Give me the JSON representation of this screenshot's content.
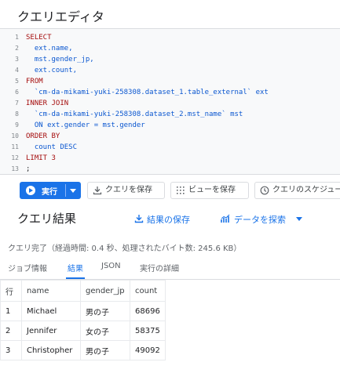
{
  "editor": {
    "title": "クエリエディタ",
    "lines": [
      {
        "num": "1",
        "text": "SELECT",
        "kind": "kw"
      },
      {
        "num": "2",
        "text": "  ext.name,",
        "kind": "code"
      },
      {
        "num": "3",
        "text": "  mst.gender_jp,",
        "kind": "code"
      },
      {
        "num": "4",
        "text": "  ext.count,",
        "kind": "code"
      },
      {
        "num": "5",
        "text": "FROM",
        "kind": "kw"
      },
      {
        "num": "6",
        "text": "  `cm-da-mikami-yuki-258308.dataset_1.table_external` ext",
        "kind": "code"
      },
      {
        "num": "7",
        "text": "INNER JOIN",
        "kind": "kw"
      },
      {
        "num": "8",
        "text": "  `cm-da-mikami-yuki-258308.dataset_2.mst_name` mst",
        "kind": "code"
      },
      {
        "num": "9",
        "text": "  ON ext.gender = mst.gender",
        "kind": "code"
      },
      {
        "num": "10",
        "text": "ORDER BY",
        "kind": "kw"
      },
      {
        "num": "11",
        "text": "  count DESC",
        "kind": "code"
      },
      {
        "num": "12",
        "text": "LIMIT 3",
        "kind": "kw"
      },
      {
        "num": "13",
        "text": ";",
        "kind": "code"
      }
    ]
  },
  "toolbar": {
    "run_label": "実行",
    "save_query_label": "クエリを保存",
    "save_view_label": "ビューを保存",
    "schedule_label": "クエリのスケジュール"
  },
  "results": {
    "title": "クエリ結果",
    "save_results_label": "結果の保存",
    "explore_data_label": "データを探索",
    "status": "クエリ完了（経過時間: 0.4 秒、処理されたバイト数: 245.6 KB）",
    "tabs": [
      "ジョブ情報",
      "結果",
      "JSON",
      "実行の詳細"
    ],
    "active_tab": "結果",
    "columns": [
      "行",
      "name",
      "gender_jp",
      "count"
    ],
    "rows": [
      [
        "1",
        "Michael",
        "男の子",
        "68696"
      ],
      [
        "2",
        "Jennifer",
        "女の子",
        "58375"
      ],
      [
        "3",
        "Christopher",
        "男の子",
        "49092"
      ]
    ]
  },
  "colors": {
    "accent": "#1a73e8",
    "keyword": "#a50e0e",
    "identifier": "#0b57d0"
  }
}
